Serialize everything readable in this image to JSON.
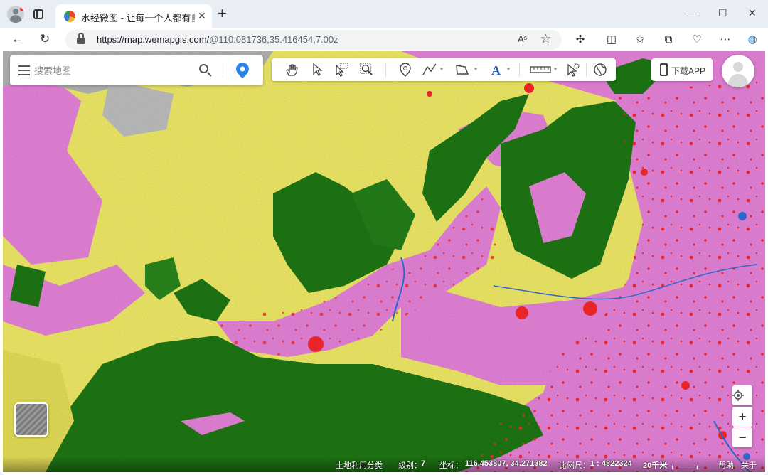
{
  "browser": {
    "tab_title": "水经微图 - 让每一个人都有自己的",
    "tab_close": "✕",
    "new_tab": "+",
    "url_host": "https://map.wemapgis.com/",
    "url_rest": "@110.081736,35.416454,7.00z",
    "read_aloud": "Aˢ",
    "window_controls": {
      "minimize": "—",
      "maximize": "☐",
      "close": "✕"
    },
    "nav": {
      "back": "←",
      "refresh": "↻"
    },
    "toolbar_icons": [
      "extensions-icon",
      "split-screen-icon",
      "favorites-icon",
      "collections-icon",
      "browser-essentials-icon",
      "more-icon",
      "edge-icon"
    ]
  },
  "map": {
    "search": {
      "placeholder": "搜索地图"
    },
    "download_label": "下载APP",
    "tools": [
      "pan-hand-icon",
      "select-pointer-icon",
      "box-select-icon",
      "zoom-box-icon",
      "marker-icon",
      "polyline-icon",
      "polygon-icon",
      "text-icon",
      "measure-ruler-icon",
      "identify-pointer-icon",
      "globe-icon"
    ],
    "zoom_in": "+",
    "zoom_out": "−",
    "status": {
      "layer_name": "土地利用分类",
      "level_label": "级别：",
      "level_value": "7",
      "coord_label": "坐标：",
      "coord_value": "116.453807, 34.271382",
      "scale_label": "比例尺：",
      "scale_value": "1 : 4822324",
      "scale_distance": "20千米",
      "help": "帮助",
      "about": "关于"
    },
    "colors": {
      "cropland": "#f7f36a",
      "forest": "#1f7a14",
      "urban_plain": "#ee7ee0",
      "settlement": "#e8262a",
      "water": "#2f66c9",
      "barren": "#b9b9b9"
    }
  }
}
